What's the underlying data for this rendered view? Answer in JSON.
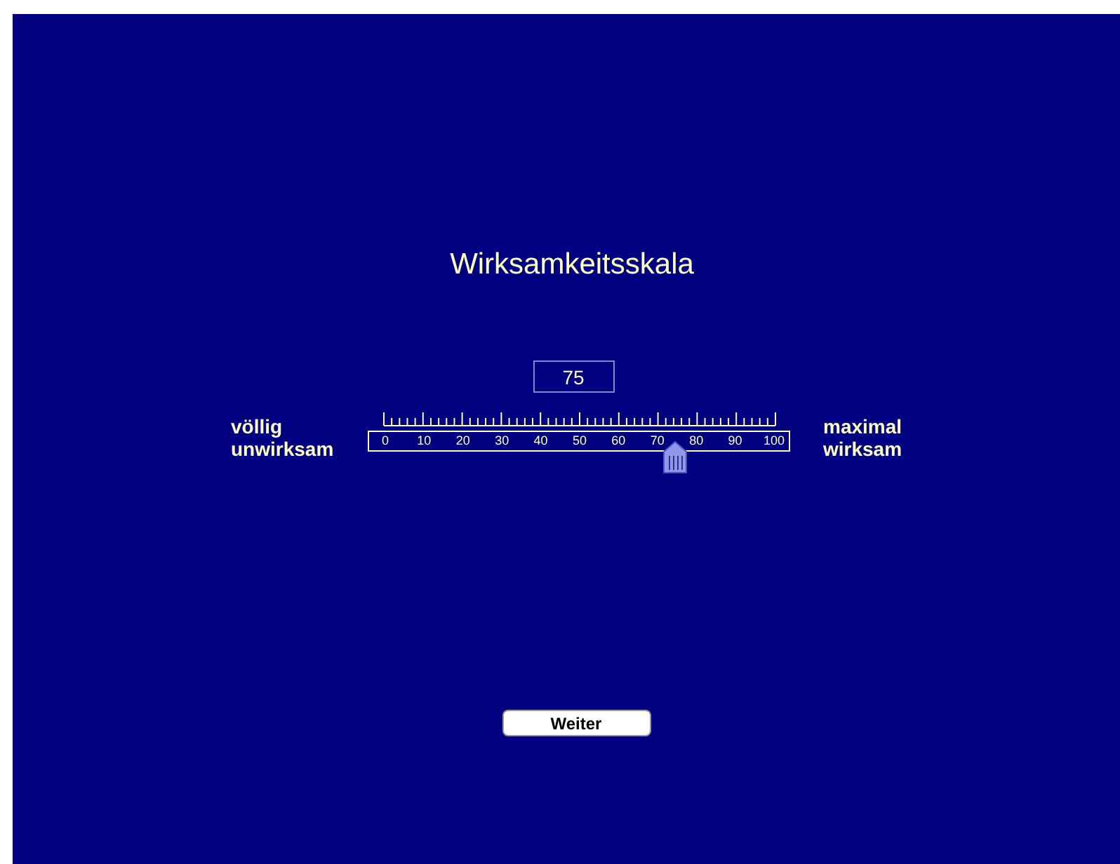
{
  "title": "Wirksamkeitsskala",
  "scale": {
    "value": "75",
    "level": 0.75,
    "left_label": [
      "völlig",
      "unwirksam"
    ],
    "right_label": [
      "maximal",
      "wirksam"
    ],
    "tick_labels": [
      "0",
      "10",
      "20",
      "30",
      "40",
      "50",
      "60",
      "70",
      "80",
      "90",
      "100"
    ]
  },
  "button": {
    "label": "Weiter"
  }
}
